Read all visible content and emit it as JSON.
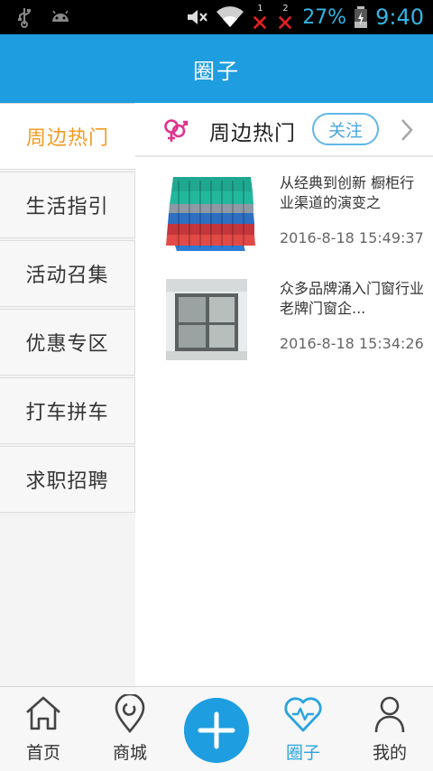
{
  "status_bar": {
    "battery_percent": "27%",
    "time": "9:40",
    "sim1_label": "1",
    "sim2_label": "2",
    "icons": [
      "usb-icon",
      "android-icon",
      "mute-icon",
      "wifi-icon",
      "sim1-no-signal-icon",
      "sim2-no-signal-icon",
      "battery-charging-icon"
    ],
    "accent_color": "#33b5e5"
  },
  "header": {
    "title": "圈子",
    "background": "#1e9de0"
  },
  "sidebar": {
    "items": [
      {
        "label": "周边热门",
        "active": true
      },
      {
        "label": "生活指引",
        "active": false
      },
      {
        "label": "活动召集",
        "active": false
      },
      {
        "label": "优惠专区",
        "active": false
      },
      {
        "label": "打车拼车",
        "active": false
      },
      {
        "label": "求职招聘",
        "active": false
      }
    ],
    "active_color": "#f59a23"
  },
  "category": {
    "icon": "gender-symbol-icon",
    "title": "周边热门",
    "follow_label": "关注"
  },
  "posts": [
    {
      "title": "从经典到创新 橱柜行业渠道的演变之",
      "time": "2016-8-18 15:49:37",
      "image": "colored-roof-tiles"
    },
    {
      "title": "众多品牌涌入门窗行业 老牌门窗企...",
      "time": "2016-8-18 15:34:26",
      "image": "window-frame"
    }
  ],
  "bottom_nav": {
    "items": [
      {
        "label": "首页",
        "icon": "home-icon",
        "active": false
      },
      {
        "label": "商城",
        "icon": "location-pin-icon",
        "active": false
      },
      {
        "label": "",
        "icon": "plus-icon",
        "active": false
      },
      {
        "label": "圈子",
        "icon": "heart-icon",
        "active": true
      },
      {
        "label": "我的",
        "icon": "person-icon",
        "active": false
      }
    ],
    "active_color": "#2aa4df"
  }
}
